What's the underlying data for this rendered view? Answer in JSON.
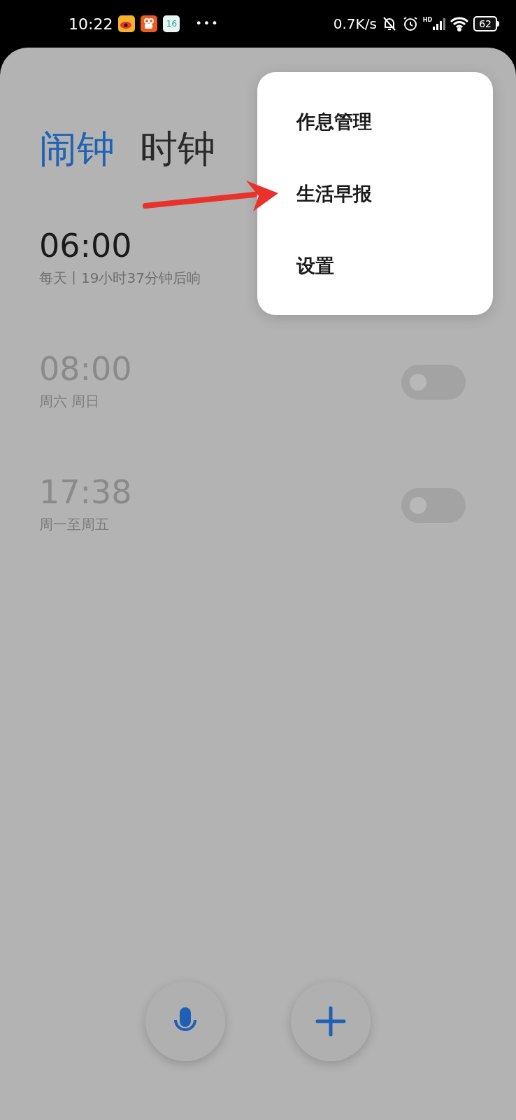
{
  "status_bar": {
    "time": "10:22",
    "calendar_badge": "16",
    "more": "•••",
    "speed": "0.7K/s",
    "signal_label": "HD",
    "battery": "62"
  },
  "tabs": [
    {
      "label": "闹钟",
      "selected": true
    },
    {
      "label": "时钟",
      "selected": false
    }
  ],
  "alarms": [
    {
      "time": "06:00",
      "repeat": "每天丨19小时37分钟后响",
      "on": true,
      "toggle_visible": false
    },
    {
      "time": "08:00",
      "repeat": "周六 周日",
      "on": false,
      "toggle_visible": true
    },
    {
      "time": "17:38",
      "repeat": "周一至周五",
      "on": false,
      "toggle_visible": true
    }
  ],
  "menu": {
    "items": [
      "作息管理",
      "生活早报",
      "设置"
    ]
  }
}
